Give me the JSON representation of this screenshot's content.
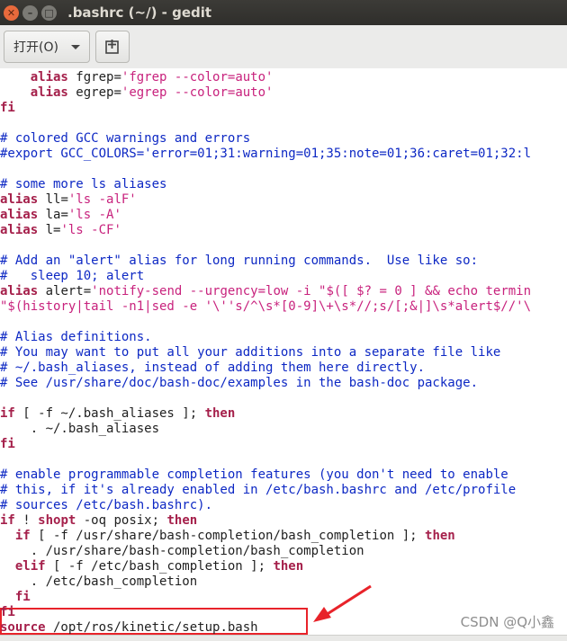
{
  "window": {
    "title": ".bashrc (~/) - gedit"
  },
  "toolbar": {
    "open_label": "打开(O)"
  },
  "code_lines": [
    [
      {
        "t": "    "
      },
      {
        "t": "alias",
        "c": "kw"
      },
      {
        "t": " fgrep="
      },
      {
        "t": "'fgrep --color=auto'",
        "c": "st"
      }
    ],
    [
      {
        "t": "    "
      },
      {
        "t": "alias",
        "c": "kw"
      },
      {
        "t": " egrep="
      },
      {
        "t": "'egrep --color=auto'",
        "c": "st"
      }
    ],
    [
      {
        "t": "fi",
        "c": "kw"
      }
    ],
    [
      {
        "t": ""
      }
    ],
    [
      {
        "t": "# colored GCC warnings and errors",
        "c": "cm"
      }
    ],
    [
      {
        "t": "#export GCC_COLORS='error=01;31:warning=01;35:note=01;36:caret=01;32:l",
        "c": "cm"
      }
    ],
    [
      {
        "t": ""
      }
    ],
    [
      {
        "t": "# some more ls aliases",
        "c": "cm"
      }
    ],
    [
      {
        "t": "alias",
        "c": "kw"
      },
      {
        "t": " ll="
      },
      {
        "t": "'ls -alF'",
        "c": "st"
      }
    ],
    [
      {
        "t": "alias",
        "c": "kw"
      },
      {
        "t": " la="
      },
      {
        "t": "'ls -A'",
        "c": "st"
      }
    ],
    [
      {
        "t": "alias",
        "c": "kw"
      },
      {
        "t": " l="
      },
      {
        "t": "'ls -CF'",
        "c": "st"
      }
    ],
    [
      {
        "t": ""
      }
    ],
    [
      {
        "t": "# Add an \"alert\" alias for long running commands.  Use like so:",
        "c": "cm"
      }
    ],
    [
      {
        "t": "#   sleep 10; alert",
        "c": "cm"
      }
    ],
    [
      {
        "t": "alias",
        "c": "kw"
      },
      {
        "t": " alert="
      },
      {
        "t": "'notify-send --urgency=low -i \"$([ $? = 0 ] && echo termin",
        "c": "st"
      }
    ],
    [
      {
        "t": "\"$(history|tail -n1|sed -e '\\''s/^\\s*[0-9]\\+\\s*//;s/[;&|]\\s*alert$//'\\",
        "c": "st"
      }
    ],
    [
      {
        "t": ""
      }
    ],
    [
      {
        "t": "# Alias definitions.",
        "c": "cm"
      }
    ],
    [
      {
        "t": "# You may want to put all your additions into a separate file like",
        "c": "cm"
      }
    ],
    [
      {
        "t": "# ~/.bash_aliases, instead of adding them here directly.",
        "c": "cm"
      }
    ],
    [
      {
        "t": "# See /usr/share/doc/bash-doc/examples in the bash-doc package.",
        "c": "cm"
      }
    ],
    [
      {
        "t": ""
      }
    ],
    [
      {
        "t": "if",
        "c": "kw"
      },
      {
        "t": " [ -f ~/.bash_aliases ]; "
      },
      {
        "t": "then",
        "c": "kw"
      }
    ],
    [
      {
        "t": "    . ~/.bash_aliases"
      }
    ],
    [
      {
        "t": "fi",
        "c": "kw"
      }
    ],
    [
      {
        "t": ""
      }
    ],
    [
      {
        "t": "# enable programmable completion features (you don't need to enable",
        "c": "cm"
      }
    ],
    [
      {
        "t": "# this, if it's already enabled in /etc/bash.bashrc and /etc/profile",
        "c": "cm"
      }
    ],
    [
      {
        "t": "# sources /etc/bash.bashrc).",
        "c": "cm"
      }
    ],
    [
      {
        "t": "if",
        "c": "kw"
      },
      {
        "t": " ! "
      },
      {
        "t": "shopt",
        "c": "kw"
      },
      {
        "t": " -oq posix; "
      },
      {
        "t": "then",
        "c": "kw"
      }
    ],
    [
      {
        "t": "  "
      },
      {
        "t": "if",
        "c": "kw"
      },
      {
        "t": " [ -f /usr/share/bash-completion/bash_completion ]; "
      },
      {
        "t": "then",
        "c": "kw"
      }
    ],
    [
      {
        "t": "    . /usr/share/bash-completion/bash_completion"
      }
    ],
    [
      {
        "t": "  "
      },
      {
        "t": "elif",
        "c": "kw"
      },
      {
        "t": " [ -f /etc/bash_completion ]; "
      },
      {
        "t": "then",
        "c": "kw"
      }
    ],
    [
      {
        "t": "    . /etc/bash_completion"
      }
    ],
    [
      {
        "t": "  "
      },
      {
        "t": "fi",
        "c": "kw"
      }
    ],
    [
      {
        "t": "fi",
        "c": "kw"
      }
    ],
    [
      {
        "t": "source",
        "c": "kw"
      },
      {
        "t": " /opt/ros/kinetic/setup.bash"
      }
    ]
  ],
  "watermark": "CSDN @Q小鑫",
  "colors": {
    "keyword": "#a5204b",
    "comment": "#0d28c4",
    "string": "#c8227d",
    "annotation": "#e8232a"
  }
}
